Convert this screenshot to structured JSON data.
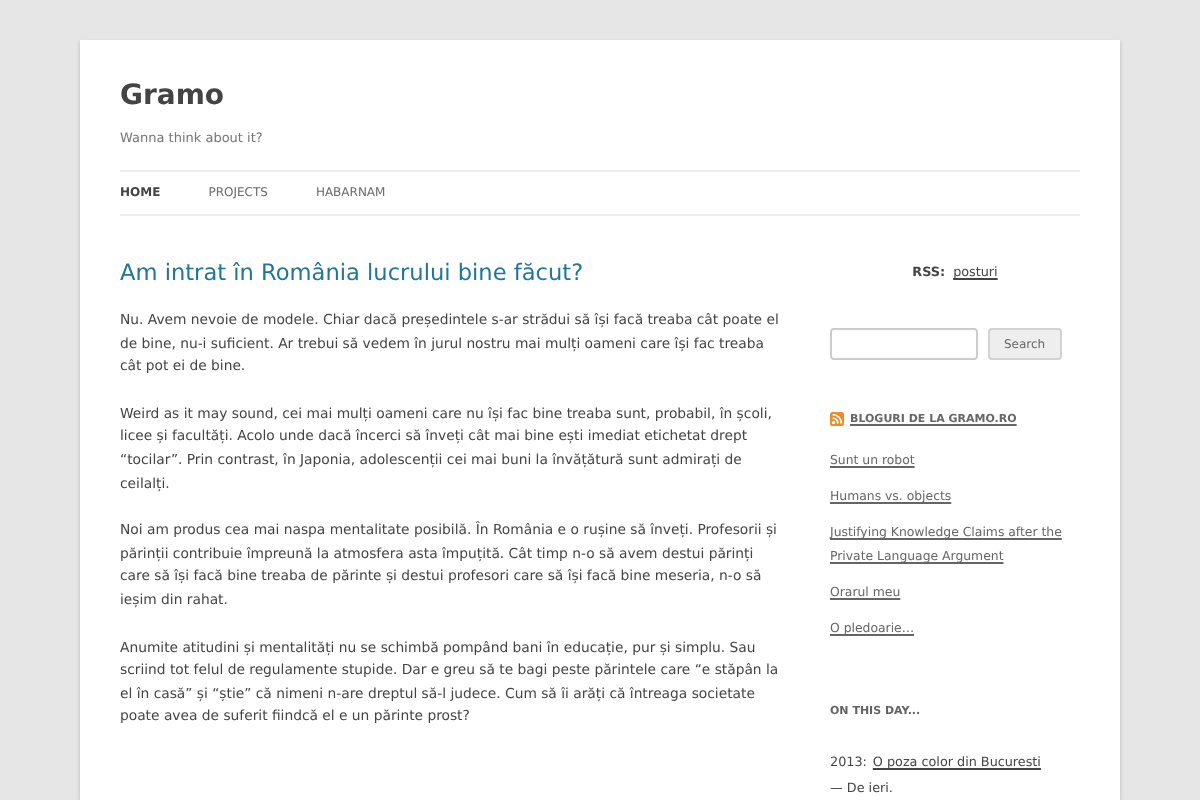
{
  "site": {
    "title": "Gramo",
    "tagline": "Wanna think about it?"
  },
  "nav": [
    {
      "label": "HOME",
      "selected": true
    },
    {
      "label": "PROJECTS",
      "selected": false
    },
    {
      "label": "HABARNAM",
      "selected": false
    }
  ],
  "post": {
    "title": "Am intrat în România lucrului bine făcut?",
    "paragraphs": [
      "Nu. Avem nevoie de modele. Chiar dacă președintele s-ar strădui să își facă treaba cât poate el de bine, nu-i suficient. Ar trebui să vedem în jurul nostru mai mulți oameni care își fac treaba cât pot ei de bine.",
      "Weird as it may sound, cei mai mulți oameni care nu își fac bine treaba sunt, probabil, în școli, licee și facultăți. Acolo unde dacă încerci să înveți cât mai bine ești imediat etichetat drept “tocilar”. Prin contrast, în Japonia, adolescenții cei mai buni la învățătură sunt admirați de ceilalți.",
      "Noi am produs cea mai naspa mentalitate posibilă. În România e o rușine să înveți. Profesorii și părinții contribuie împreună la atmosfera asta împuțită. Cât timp n-o să avem destui părinți care să își facă bine treaba de părinte și destui profesori care să își facă bine meseria, n-o să ieșim din rahat.",
      "Anumite atitudini și mentalități nu se schimbă pompând bani în educație, pur și simplu. Sau scriind tot felul de regulamente stupide. Dar e greu să te bagi peste părintele care “e stăpân la el în casă” și “știe” că nimeni n-are dreptul să-l judece. Cum să îi arăți că întreaga societate poate avea de suferit fiindcă el e un părinte prost?"
    ]
  },
  "sidebar": {
    "rss_label": "RSS:",
    "rss_link": "posturi",
    "search_button": "Search",
    "feed_title": "BLOGURI DE LA GRAMO.RO",
    "feed_links": [
      "Sunt un robot",
      "Humans vs. objects",
      "Justifying Knowledge Claims after the Private Language Argument",
      "Orarul meu",
      "O pledoarie…"
    ],
    "on_this_day": {
      "heading": "ON THIS DAY...",
      "year": "2013:",
      "link": "O poza color din Bucuresti",
      "rest": "— De ieri."
    }
  }
}
